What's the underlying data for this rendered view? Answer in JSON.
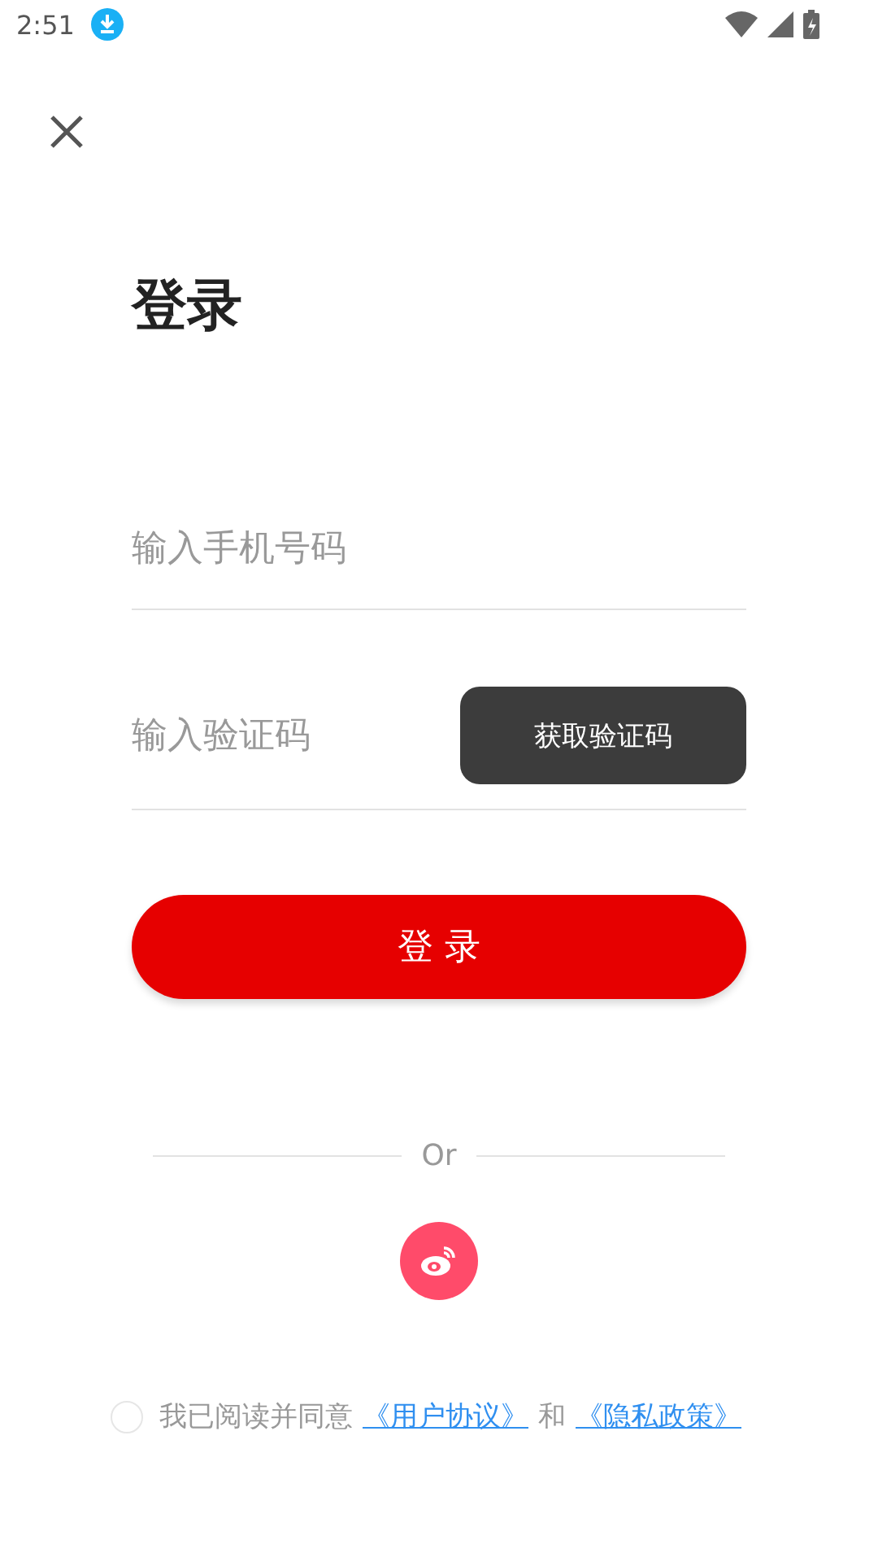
{
  "status_bar": {
    "time": "2:51"
  },
  "title": "登录",
  "phone_field": {
    "placeholder": "输入手机号码"
  },
  "code_field": {
    "placeholder": "输入验证码"
  },
  "get_code_button": "获取验证码",
  "login_button": "登 录",
  "divider_label": "Or",
  "agreement": {
    "checked": false,
    "text": "我已阅读并同意",
    "links": [
      "《用户协议》",
      "《隐私政策》"
    ],
    "conjunction": "和"
  }
}
